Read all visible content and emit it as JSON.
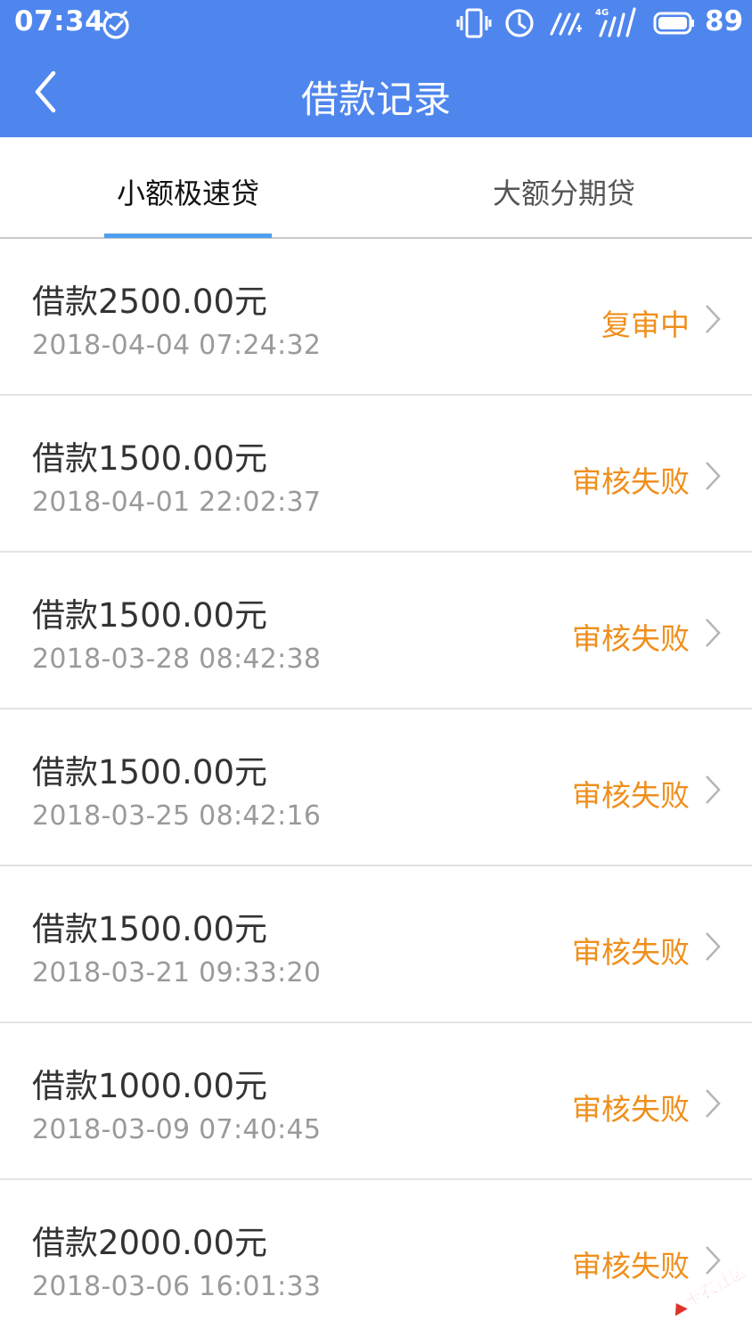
{
  "status_bar": {
    "time": "07:34",
    "battery_level": "89",
    "signal_label": "4G"
  },
  "header": {
    "title": "借款记录"
  },
  "tabs": [
    {
      "label": "小额极速贷",
      "active": true
    },
    {
      "label": "大额分期贷",
      "active": false
    }
  ],
  "loans": [
    {
      "amount": "借款2500.00元",
      "time": "2018-04-04 07:24:32",
      "status": "复审中"
    },
    {
      "amount": "借款1500.00元",
      "time": "2018-04-01 22:02:37",
      "status": "审核失败"
    },
    {
      "amount": "借款1500.00元",
      "time": "2018-03-28 08:42:38",
      "status": "审核失败"
    },
    {
      "amount": "借款1500.00元",
      "time": "2018-03-25 08:42:16",
      "status": "审核失败"
    },
    {
      "amount": "借款1500.00元",
      "time": "2018-03-21 09:33:20",
      "status": "审核失败"
    },
    {
      "amount": "借款1000.00元",
      "time": "2018-03-09 07:40:45",
      "status": "审核失败"
    },
    {
      "amount": "借款2000.00元",
      "time": "2018-03-06 16:01:33",
      "status": "审核失败"
    }
  ],
  "watermark": {
    "text": "卡农社区"
  },
  "colors": {
    "header_blue": "#4f86ee",
    "tab_indicator": "#4f9ff0",
    "status_orange": "#ef8f1c"
  }
}
